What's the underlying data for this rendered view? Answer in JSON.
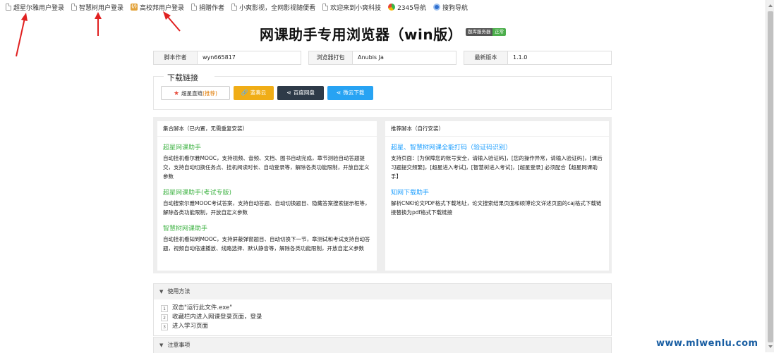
{
  "bookmarks": [
    {
      "label": "超星尔雅用户登录",
      "icon": "page-icon"
    },
    {
      "label": "智慧树用户登录",
      "icon": "page-icon"
    },
    {
      "label": "高校邦用户登录",
      "icon": "bookmark-badge-icon"
    },
    {
      "label": "捐赠作者",
      "icon": "page-icon"
    },
    {
      "label": "小爽影视，全网影视随便看",
      "icon": "page-icon"
    },
    {
      "label": "欢迎来到小爽科技",
      "icon": "page-icon"
    },
    {
      "label": "2345导航",
      "icon": "2345-logo-icon"
    },
    {
      "label": "搜狗导航",
      "icon": "sogou-logo-icon"
    }
  ],
  "page": {
    "title": "网课助手专用浏览器（win版）",
    "tag_left": "题库服务器",
    "tag_right": "正常"
  },
  "info": {
    "author_label": "脚本作者",
    "author_value": "wyn665817",
    "packager_label": "浏览器打包",
    "packager_value": "Anubis Ja",
    "version_label": "最新版本",
    "version_value": "1.1.0"
  },
  "download": {
    "legend": "下载链接",
    "chaoxing_label": "超星直链",
    "chaoxing_rec": "(推荐)",
    "lanzou_label": "蓝奏云",
    "baidu_label": "百度网盘",
    "duoyun_label": "微云下载"
  },
  "scripts": {
    "left_header": "集合脚本（已内置，无需重复安装）",
    "left_items": [
      {
        "name": "超星网课助手",
        "desc": "自动挂机看尔雅MOOC，支持视频、音频、文档、图书自动完成，章节测验自动答题提交，支持自动切换任务点、挂机阅读时长、自动登录等，解除各类功能限制，开放自定义参数"
      },
      {
        "name": "超星网课助手(考试专版)",
        "desc": "自动搜索尔雅MOOC考试答案，支持自动答题、自动切换题目、隐藏答案搜索提示框等，解除各类功能限制，开放自定义参数"
      },
      {
        "name": "智慧树网课助手",
        "desc": "自动挂机看知到MOOC，支持屏蔽弹窗题目、自动切换下一节，章测试和考试支持自动答题，视频自动倍速播放、线路选择、默认静音等，解除各类功能限制，开放自定义参数"
      }
    ],
    "right_header": "推荐脚本（自行安装）",
    "right_items": [
      {
        "name": "超星、智慧树网课全能打码（验证码识别）",
        "desc": "支持页面：[为保障您的账号安全，请输入验证码]，[您的操作异常，请输入验证码]，[课后习题提交频繁]，[超星进入考试]，[智慧树进入考试]，[超星登录] 必须配合【超星网课助手】"
      },
      {
        "name": "知网下载助手",
        "desc": "解析CNKI论文PDF格式下载地址，论文搜索结果页面和硕博论文详述页面的caj格式下载链接替换为pdf格式下载链接"
      }
    ]
  },
  "usage": {
    "title": "使用方法",
    "steps": [
      "双击\"运行此文件.exe\"",
      "收藏栏内进入网课登录页面，登录",
      "进入学习页面"
    ],
    "step_numbers": [
      "1",
      "2",
      "3"
    ]
  },
  "notes": {
    "title": "注意事项"
  },
  "watermark": "www.mlwenlu.com",
  "colors": {
    "green": "#44b549",
    "blue": "#1e9fff",
    "orange": "#f0ad16",
    "dark": "#2e3a48",
    "cyan": "#27a3f3",
    "annotation_red": "#e02020"
  }
}
